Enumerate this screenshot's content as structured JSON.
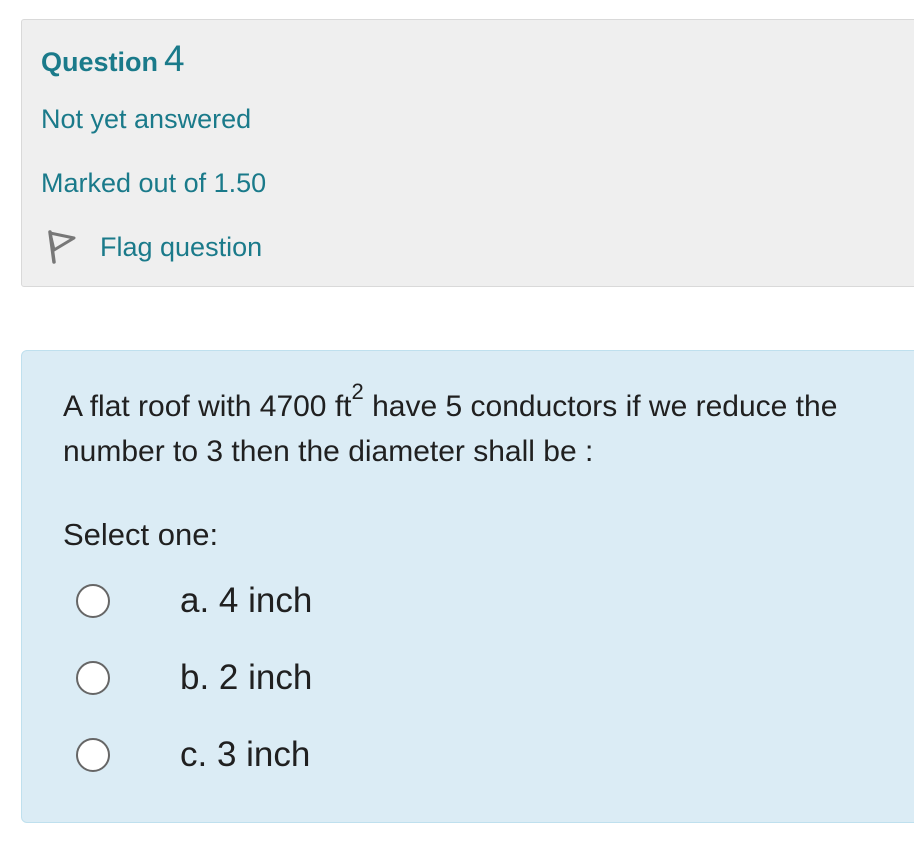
{
  "info": {
    "question_label": "Question",
    "question_number": "4",
    "state": "Not yet answered",
    "grade": "Marked out of 1.50",
    "flag_label": "Flag question",
    "flag_icon": "flag-icon"
  },
  "question": {
    "text_before": "A flat roof with 4700 ft",
    "superscript": "2",
    "text_after": " have 5 conductors if we reduce the number to 3 then the diameter shall be  :",
    "prompt": "Select one:",
    "options": [
      {
        "label": "a. 4 inch",
        "selected": false
      },
      {
        "label": "b. 2 inch",
        "selected": false
      },
      {
        "label": "c. 3 inch",
        "selected": false
      }
    ]
  },
  "colors": {
    "accent": "#1a7a8a",
    "info_bg": "#efefef",
    "question_bg": "#dbecf5"
  }
}
